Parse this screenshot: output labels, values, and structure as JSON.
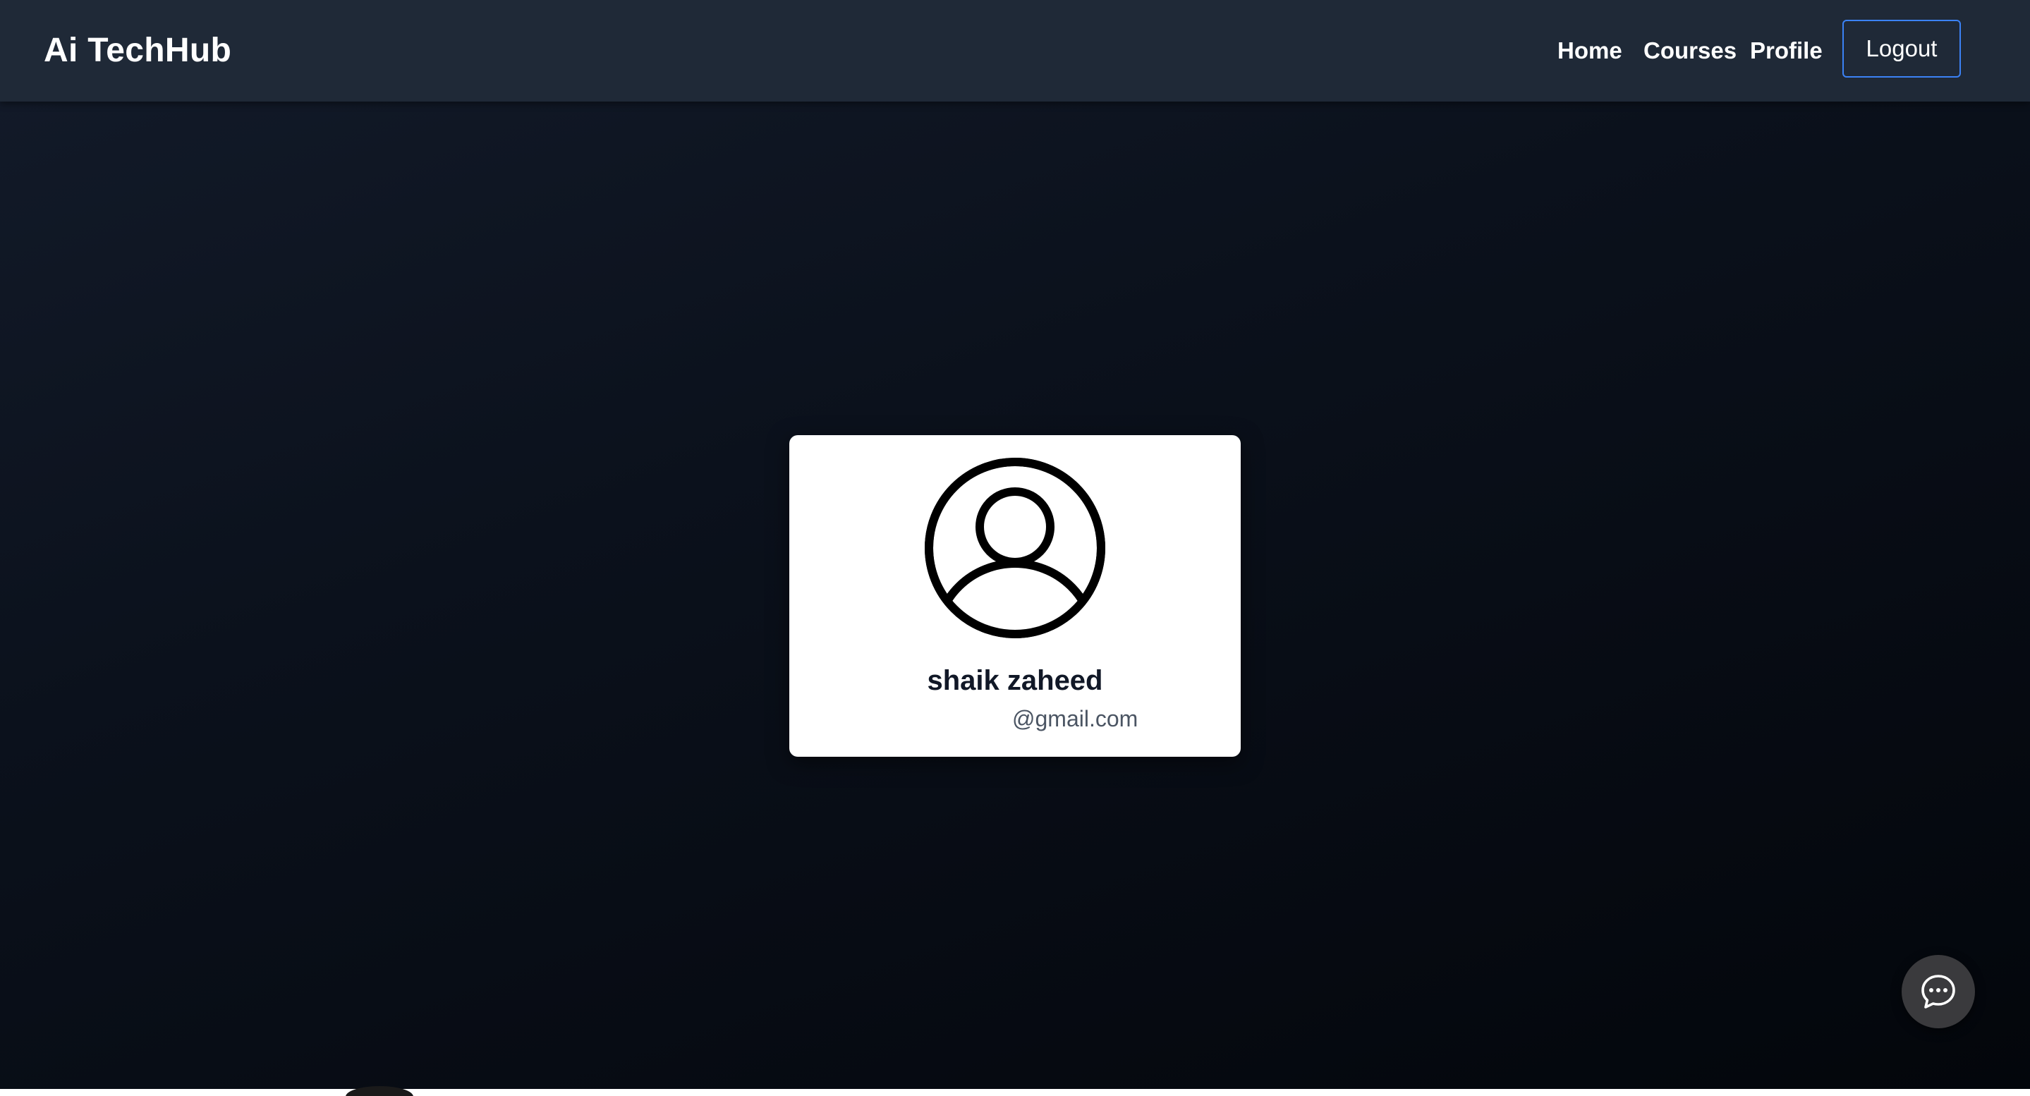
{
  "brand": {
    "title": "Ai TechHub"
  },
  "nav": {
    "home_label": "Home",
    "courses_label": "Courses",
    "profile_label": "Profile",
    "logout_label": "Logout"
  },
  "profile_card": {
    "avatar_icon": "user-circle-icon",
    "name": "shaik zaheed",
    "email": "@gmail.com"
  },
  "chat_button": {
    "icon": "chat-bubble-icon"
  },
  "colors": {
    "navbar_bg": "#1f2937",
    "logout_border": "#3b82f6",
    "card_bg": "#ffffff",
    "chat_fab_bg": "#3a3a3d"
  }
}
